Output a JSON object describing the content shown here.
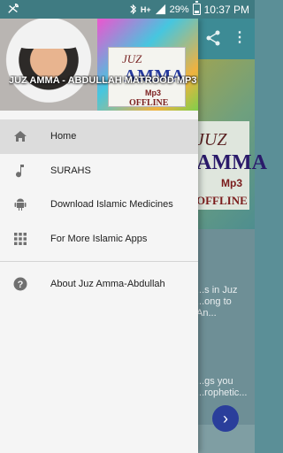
{
  "status_bar": {
    "time": "10:37 PM",
    "battery_percent": "29%",
    "network": "H+",
    "icons": [
      "tools-icon",
      "bluetooth-icon",
      "signal-icon",
      "battery-icon"
    ]
  },
  "background": {
    "hero_juz": "JUZ",
    "hero_amma": "AMMA",
    "hero_mp3": "Mp3",
    "hero_offline": "OFFLINE",
    "card_1_text": "...s in Juz\n...ong to An...",
    "card_2_text": "...gs you\n...rophetic...",
    "fab_icon": "chevron-right-icon"
  },
  "drawer": {
    "title": "JUZ AMMA - ABDULLAH MATROOD MP3",
    "logo": {
      "juz": "JUZ",
      "amma": "AMMA",
      "mp3": "Mp3",
      "offline": "OFFLINE"
    },
    "items": [
      {
        "label": "Home",
        "icon": "home-icon",
        "active": true
      },
      {
        "label": "SURAHS",
        "icon": "music-note-icon",
        "active": false
      },
      {
        "label": "Download Islamic Medicines",
        "icon": "android-icon",
        "active": false
      },
      {
        "label": "For More Islamic Apps",
        "icon": "apps-grid-icon",
        "active": false
      }
    ],
    "footer_item": {
      "label": "About Juz Amma-Abdullah",
      "icon": "help-icon"
    }
  },
  "colors": {
    "status_bar": "#3f7b82",
    "toolbar": "#3d8b95",
    "drawer_bg": "#f5f5f5",
    "active_item": "#dcdcdc",
    "icon_gray": "#707070"
  }
}
